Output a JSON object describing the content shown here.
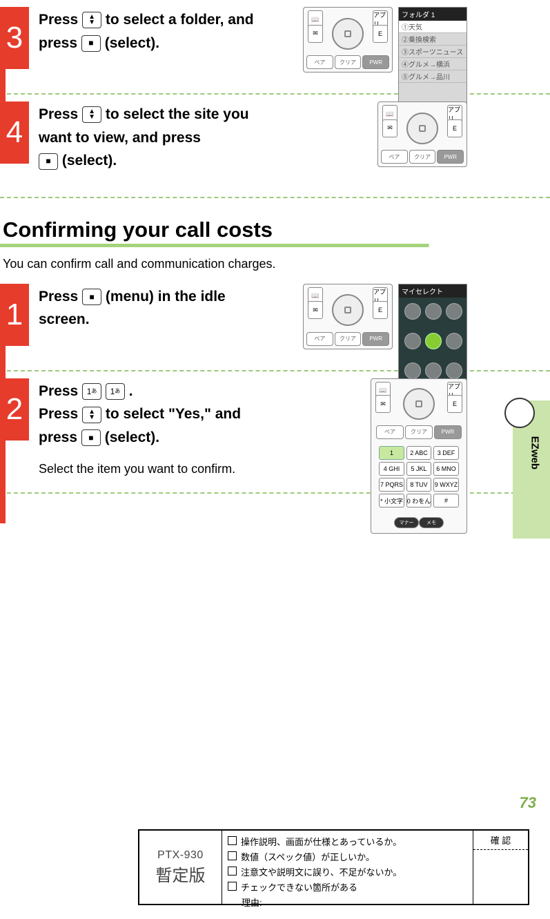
{
  "steps_a": [
    {
      "num": "3",
      "text_parts": [
        "Press ",
        " to select a folder, and press ",
        " (select)."
      ],
      "key_icons": [
        "updown",
        "square"
      ]
    },
    {
      "num": "4",
      "text_parts": [
        "Press ",
        " to select the site you want to view, and press ",
        " (select)."
      ],
      "key_icons": [
        "updown",
        "square"
      ]
    }
  ],
  "section": {
    "title": "Confirming your call costs",
    "subtitle": "You can confirm call and communication charges."
  },
  "steps_b": [
    {
      "num": "1",
      "text_parts": [
        "Press ",
        " (menu) in the idle screen."
      ],
      "key_icons": [
        "square"
      ]
    },
    {
      "num": "2",
      "text_parts": [
        "Press ",
        " ",
        ".",
        "Press ",
        " to select \"Yes,\" and press ",
        " (select)."
      ],
      "key_icons": [
        "one",
        "one",
        "",
        "updown",
        "square"
      ],
      "note": "Select the item you want to confirm."
    }
  ],
  "screen_list": {
    "header": "フォルダ 1",
    "items": [
      "①天気",
      "②乗換検索",
      "③スポーツニュース",
      "④グルメ→横浜",
      "⑤グルメ→品川"
    ]
  },
  "screen_myselect": "マイセレクト",
  "keypad_labels": {
    "appli": "アプリ",
    "book": "📖",
    "mail": "✉",
    "e": "E",
    "pair": "ペア",
    "clear": "クリア",
    "pwr": "PWR"
  },
  "numpad": [
    "1",
    "2 ABC",
    "3 DEF",
    "4 GHI",
    "5 JKL",
    "6 MNO",
    "7 PQRS",
    "8 TUV",
    "9 WXYZ",
    "* 小文字",
    "0 わをん",
    "#"
  ],
  "oval_keys": [
    "マナー",
    "メモ"
  ],
  "side_label": "EZweb",
  "page_number": "73",
  "footer": {
    "model": "PTX-930",
    "tentative": "暫定版",
    "checks": [
      "操作説明、画面が仕様とあっているか。",
      "数値（スペック値）が正しいか。",
      "注意文や説明文に誤り、不足がないか。",
      "チェックできない箇所がある"
    ],
    "reason_label": "理由:",
    "confirm": "確 認"
  }
}
